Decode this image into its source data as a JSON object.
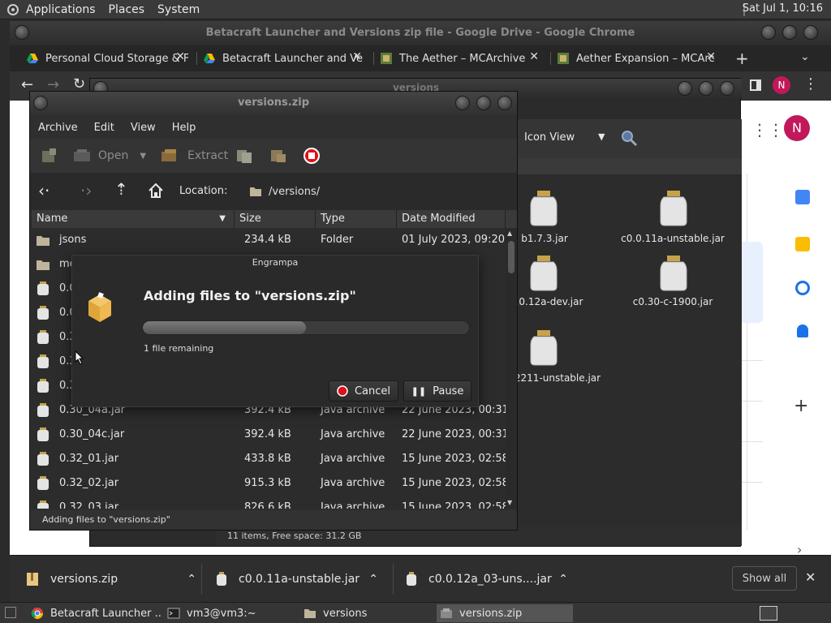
{
  "top_panel": {
    "menus": [
      "Applications",
      "Places",
      "System"
    ],
    "clock": "Sat Jul 1, 10:16"
  },
  "chrome": {
    "title": "Betacraft Launcher and Versions zip file - Google Drive - Google Chrome",
    "tabs": [
      {
        "label": "Personal Cloud Storage & F"
      },
      {
        "label": "Betacraft Launcher and Ve"
      },
      {
        "label": "The Aether – MCArchive"
      },
      {
        "label": "Aether Expansion – MCArc"
      }
    ],
    "profile_initial": "N"
  },
  "caja": {
    "title": "versions",
    "view_mode": "Icon View",
    "items": [
      {
        "label": "b1.7.3.jar"
      },
      {
        "label": "c0.0.11a-unstable.jar"
      },
      {
        "label": ".0.12a-dev.jar"
      },
      {
        "label": "c0.30-c-1900.jar"
      },
      {
        "label": "2211-unstable.jar"
      }
    ],
    "status": "11 items, Free space: 31.2 GB"
  },
  "engrampa": {
    "title": "versions.zip",
    "menu": [
      "Archive",
      "Edit",
      "View",
      "Help"
    ],
    "toolbar": {
      "open": "Open",
      "extract": "Extract"
    },
    "location_label": "Location:",
    "location_value": "/versions/",
    "columns": [
      "Name",
      "Size",
      "Type",
      "Date Modified"
    ],
    "rows": [
      {
        "name": "jsons",
        "size": "234.4 kB",
        "type": "Folder",
        "date": "01 July 2023, 09:20"
      },
      {
        "name": "mc",
        "size": "",
        "type": "",
        "date": "24"
      },
      {
        "name": "0.0",
        "size": "",
        "type": "",
        "date": ":54"
      },
      {
        "name": "0.0",
        "size": "",
        "type": "",
        "date": ":51"
      },
      {
        "name": "0.3",
        "size": "",
        "type": "",
        "date": "0:31"
      },
      {
        "name": "0.3",
        "size": "",
        "type": "",
        "date": "0:31"
      },
      {
        "name": "0.3",
        "size": "",
        "type": "",
        "date": "0:31"
      },
      {
        "name": "0.30_04a.jar",
        "size": "392.4 kB",
        "type": "Java archive",
        "date": "22 June 2023, 00:31"
      },
      {
        "name": "0.30_04c.jar",
        "size": "392.4 kB",
        "type": "Java archive",
        "date": "22 June 2023, 00:31"
      },
      {
        "name": "0.32_01.jar",
        "size": "433.8 kB",
        "type": "Java archive",
        "date": "15 June 2023, 02:58"
      },
      {
        "name": "0.32_02.jar",
        "size": "915.3 kB",
        "type": "Java archive",
        "date": "15 June 2023, 02:58"
      },
      {
        "name": "0.32_03.jar",
        "size": "826.6 kB",
        "type": "Java archive",
        "date": "15 June 2023, 02:58"
      }
    ],
    "status": "Adding files to \"versions.zip\""
  },
  "dialog": {
    "title": "Engrampa",
    "heading": "Adding files to \"versions.zip\"",
    "progress_fraction": 0.5,
    "remaining": "1 file remaining",
    "cancel_label": "Cancel",
    "pause_label": "Pause"
  },
  "downloads": {
    "items": [
      {
        "label": "versions.zip"
      },
      {
        "label": "c0.0.11a-unstable.jar"
      },
      {
        "label": "c0.0.12a_03-uns....jar"
      }
    ],
    "show_all": "Show all"
  },
  "taskbar": {
    "items": [
      {
        "label": "Betacraft Launcher ..."
      },
      {
        "label": "vm3@vm3:~"
      },
      {
        "label": "versions"
      },
      {
        "label": "versions.zip"
      }
    ]
  },
  "colors": {
    "cancel_red": "#e0101a",
    "progress_fill": "#6a6a6a",
    "avatar": "#c2185b"
  }
}
